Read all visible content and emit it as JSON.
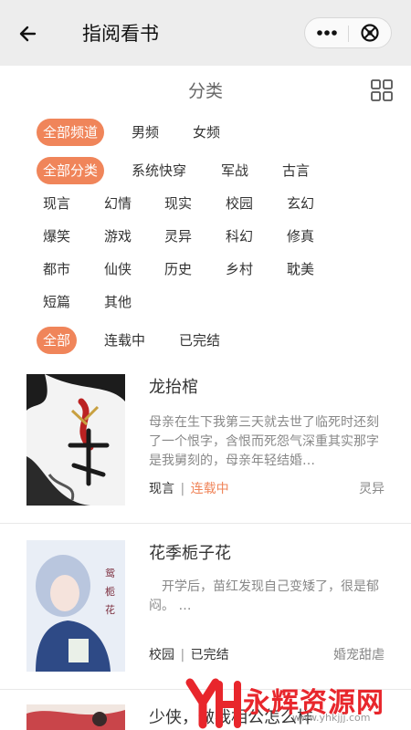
{
  "header": {
    "title": "指阅看书"
  },
  "category": {
    "title": "分类"
  },
  "channels": [
    "全部频道",
    "男频",
    "女频"
  ],
  "genres": [
    "全部分类",
    "系统快穿",
    "军战",
    "古言",
    "现言",
    "幻情",
    "现实",
    "校园",
    "玄幻",
    "爆笑",
    "游戏",
    "灵异",
    "科幻",
    "修真",
    "都市",
    "仙侠",
    "历史",
    "乡村",
    "耽美",
    "短篇",
    "其他"
  ],
  "statuses": [
    "全部",
    "连载中",
    "已完结"
  ],
  "books": [
    {
      "title": "龙抬棺",
      "desc": "母亲在生下我第三天就去世了临死时还刻了一个恨字，含恨而死怨气深重其实那字是我舅刻的，母亲年轻结婚…",
      "genre": "现言",
      "status": "连载中",
      "category": "灵异"
    },
    {
      "title": "花季栀子花",
      "desc": "　开学后，苗红发现自己变矮了，很是郁闷。 …",
      "genre": "校园",
      "status": "已完结",
      "category": "婚宠甜虐"
    },
    {
      "title": "少侠，做我相公怎么样"
    }
  ],
  "watermark": {
    "text": "永辉资源网",
    "url": "www.yhkjjj.com"
  },
  "colors": {
    "accent": "#f0855a",
    "topbar": "#ededed"
  }
}
